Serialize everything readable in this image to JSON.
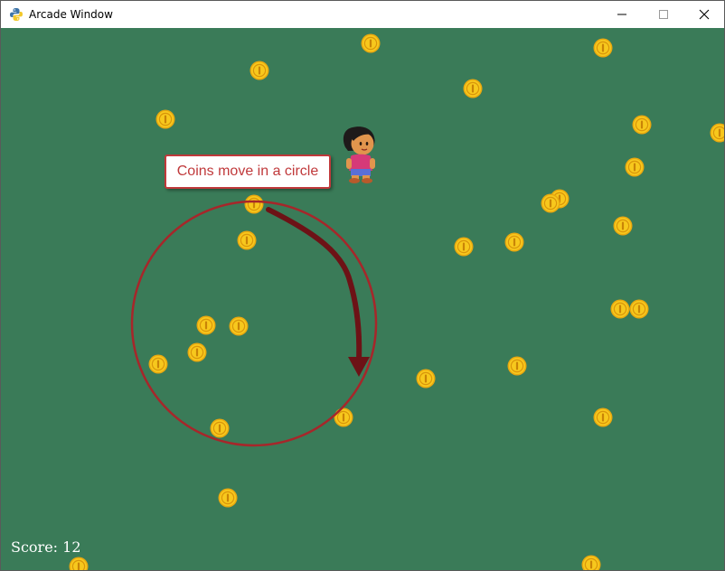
{
  "window": {
    "title": "Arcade Window",
    "icons": {
      "app": "python-icon",
      "minimize": "minimize-icon",
      "maximize": "maximize-icon",
      "close": "close-icon"
    }
  },
  "game": {
    "background_color": "#3a7b58",
    "score_text": "Score: 12",
    "annotation": {
      "label": "Coins move in a circle",
      "color": "#c0393b",
      "circle_color": "#a7262a",
      "arrow_color": "#6d1216"
    },
    "player": {
      "sprite": "female-adventurer-sprite"
    },
    "coin": {
      "sprite": "gold-coin",
      "color": "#f5c518",
      "count": 33
    }
  }
}
